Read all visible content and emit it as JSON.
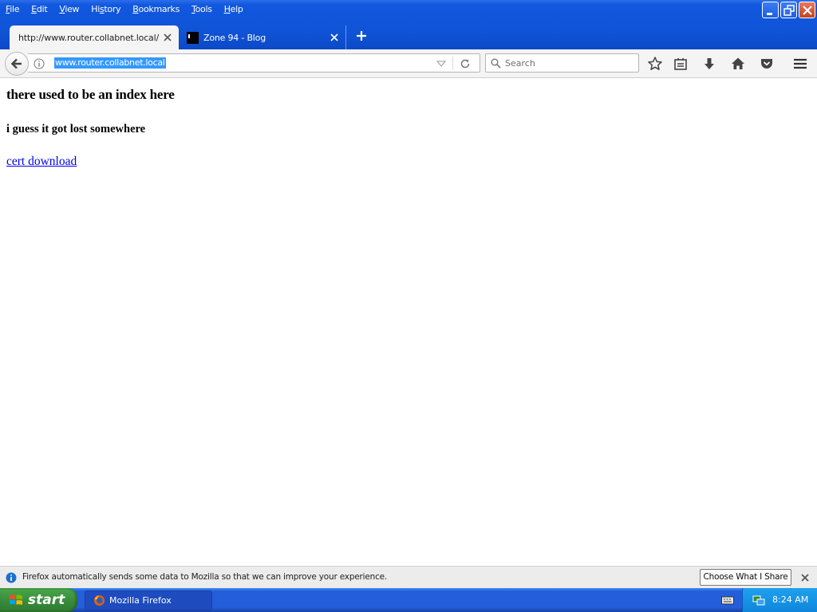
{
  "menu": {
    "items": [
      {
        "u": "F",
        "rest": "ile"
      },
      {
        "u": "E",
        "rest": "dit"
      },
      {
        "u": "V",
        "rest": "iew"
      },
      {
        "pre": "Hi",
        "u": "s",
        "rest": "tory"
      },
      {
        "u": "B",
        "rest": "ookmarks"
      },
      {
        "u": "T",
        "rest": "ools"
      },
      {
        "u": "H",
        "rest": "elp"
      }
    ]
  },
  "tabs": [
    {
      "title": "http://www.router.collabnet.local/",
      "active": true
    },
    {
      "title": "Zone 94 - Blog",
      "active": false
    }
  ],
  "navbar": {
    "url": "www.router.collabnet.local",
    "search_placeholder": "Search"
  },
  "page": {
    "heading": "there used to be an index here",
    "subheading": "i guess it got lost somewhere",
    "link_text": "cert download"
  },
  "notification": {
    "text": "Firefox automatically sends some data to Mozilla so that we can improve your experience.",
    "button": "Choose What I Share"
  },
  "taskbar": {
    "start_label": "start",
    "task_label": "Mozilla Firefox",
    "clock": "8:24 AM"
  },
  "colors": {
    "titlebar": "#0f54d6",
    "link": "#0000ee",
    "url_highlight": "#3399ff",
    "taskbar": "#245edb",
    "start": "#37893a"
  }
}
